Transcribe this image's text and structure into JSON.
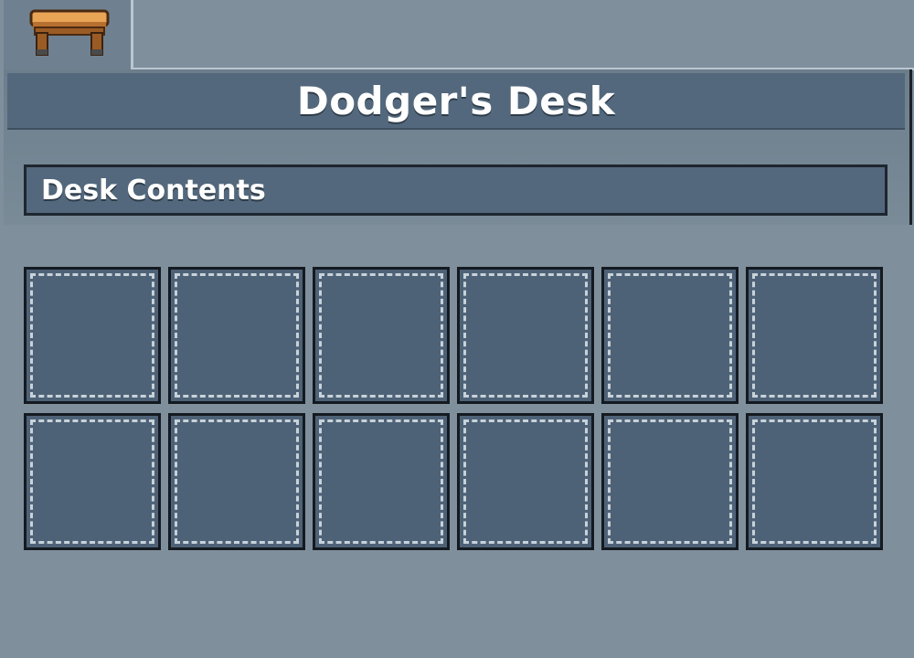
{
  "window": {
    "title": "Dodger's Desk",
    "tab_icon": "wooden-desk-icon"
  },
  "section": {
    "label": "Desk Contents"
  },
  "inventory": {
    "rows": 2,
    "columns": 6,
    "slots": [
      {
        "item": null
      },
      {
        "item": null
      },
      {
        "item": null
      },
      {
        "item": null
      },
      {
        "item": null
      },
      {
        "item": null
      },
      {
        "item": null
      },
      {
        "item": null
      },
      {
        "item": null
      },
      {
        "item": null
      },
      {
        "item": null
      },
      {
        "item": null
      }
    ]
  },
  "colors": {
    "background": "#7f8f9c",
    "title_bar": "#53687c",
    "slot_fill": "#4e6277",
    "slot_border": "#141a20",
    "slot_dash": "#c8d2da",
    "desk_wood": "#d9903f"
  }
}
